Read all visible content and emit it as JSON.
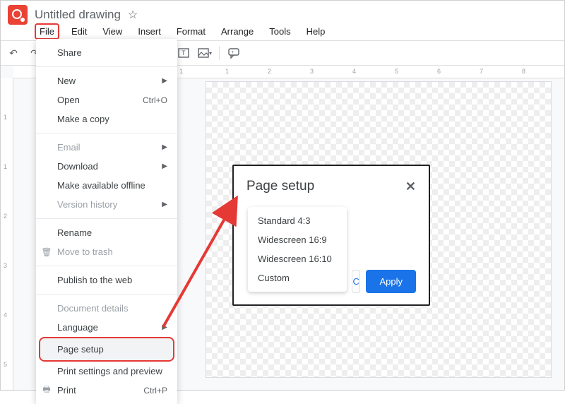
{
  "header": {
    "doc_title": "Untitled drawing"
  },
  "menubar": [
    "File",
    "Edit",
    "View",
    "Insert",
    "Format",
    "Arrange",
    "Tools",
    "Help"
  ],
  "ruler_h": [
    "1",
    "1",
    "2",
    "3",
    "4",
    "5",
    "6",
    "7",
    "8"
  ],
  "ruler_v": [
    "1",
    "1",
    "2",
    "3",
    "4",
    "5"
  ],
  "file_menu": {
    "share": "Share",
    "new": "New",
    "open": "Open",
    "open_shortcut": "Ctrl+O",
    "make_copy": "Make a copy",
    "email": "Email",
    "download": "Download",
    "offline": "Make available offline",
    "version_history": "Version history",
    "rename": "Rename",
    "move_trash": "Move to trash",
    "publish": "Publish to the web",
    "doc_details": "Document details",
    "language": "Language",
    "page_setup": "Page setup",
    "print_settings": "Print settings and preview",
    "print": "Print",
    "print_shortcut": "Ctrl+P"
  },
  "dialog": {
    "title": "Page setup",
    "options": [
      "Standard 4:3",
      "Widescreen 16:9",
      "Widescreen 16:10",
      "Custom"
    ],
    "cancel": "Cancel",
    "apply": "Apply"
  }
}
